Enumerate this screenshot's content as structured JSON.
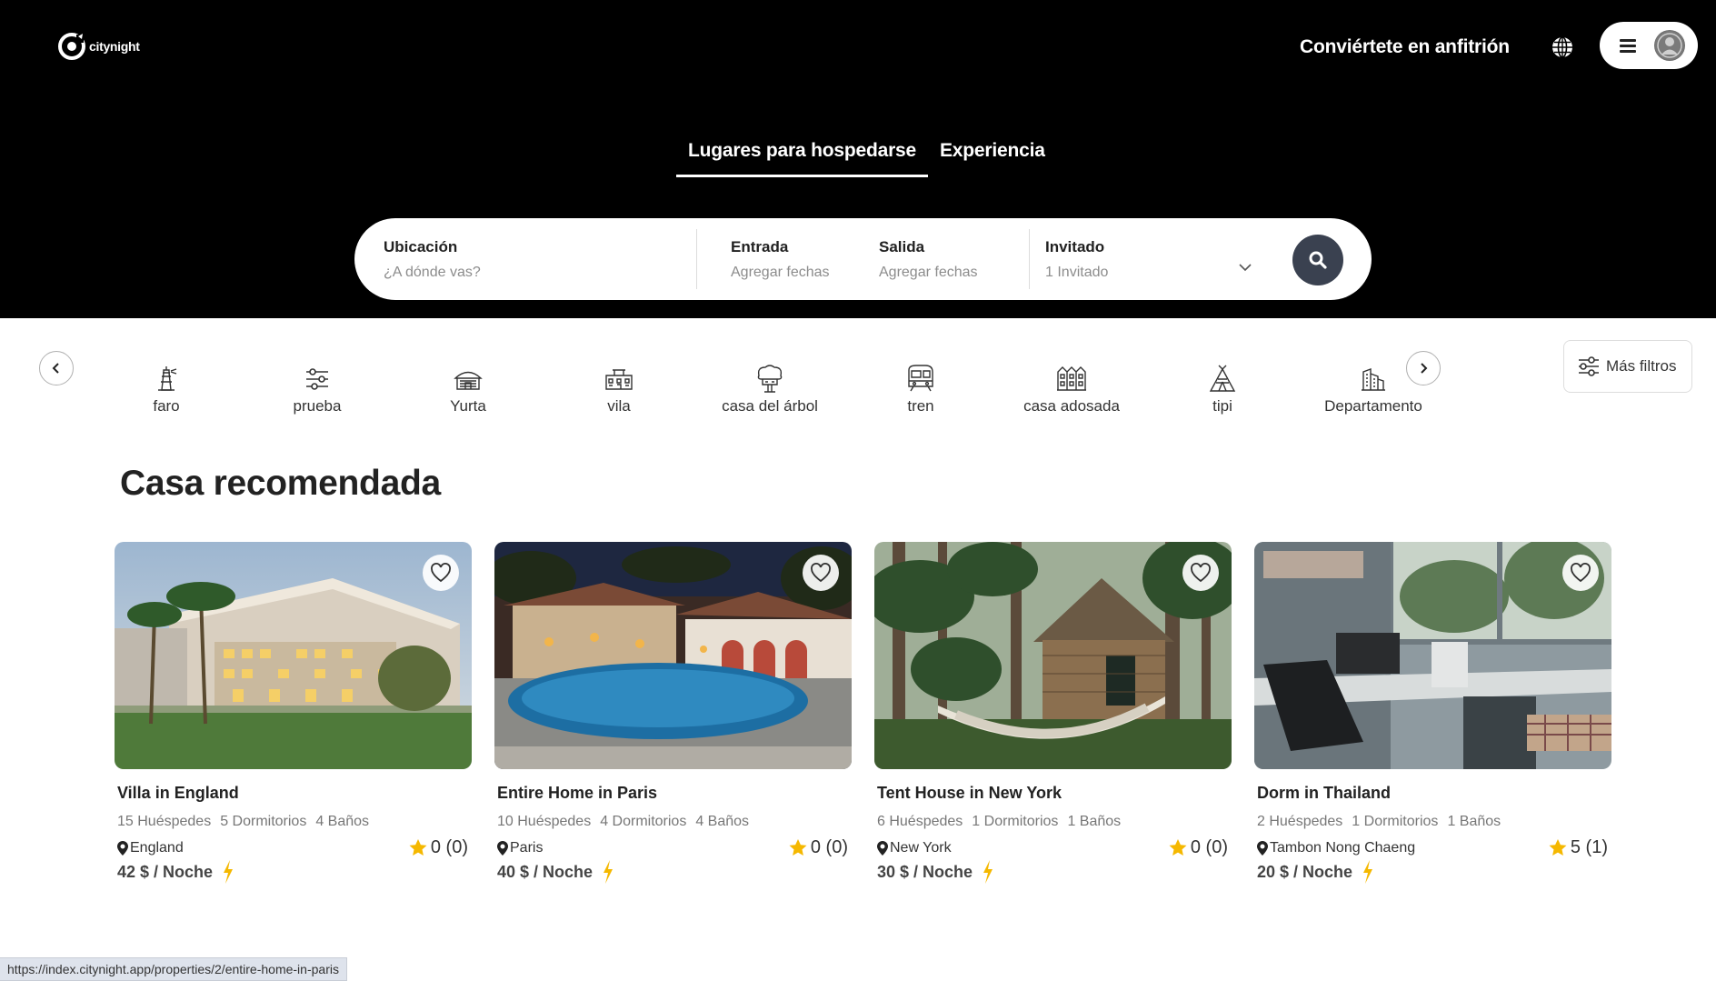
{
  "header": {
    "logo_text": "citynight",
    "host_label": "Conviértete en anfitrión",
    "tabs": [
      {
        "label": "Lugares para hospedarse",
        "active": true
      },
      {
        "label": "Experiencia",
        "active": false
      }
    ]
  },
  "search": {
    "location": {
      "label": "Ubicación",
      "placeholder": "¿A dónde vas?"
    },
    "checkin": {
      "label": "Entrada",
      "placeholder": "Agregar fechas"
    },
    "checkout": {
      "label": "Salida",
      "placeholder": "Agregar fechas"
    },
    "guests": {
      "label": "Invitado",
      "value": "1 Invitado"
    }
  },
  "categories": {
    "items": [
      {
        "label": "faro",
        "icon": "lighthouse-icon"
      },
      {
        "label": "prueba",
        "icon": "sliders-icon"
      },
      {
        "label": "Yurta",
        "icon": "yurt-icon"
      },
      {
        "label": "vila",
        "icon": "villa-icon"
      },
      {
        "label": "casa del árbol",
        "icon": "treehouse-icon"
      },
      {
        "label": "tren",
        "icon": "train-icon"
      },
      {
        "label": "casa adosada",
        "icon": "townhouse-icon"
      },
      {
        "label": "tipi",
        "icon": "tipi-icon"
      },
      {
        "label": "Departamento",
        "icon": "apartment-icon"
      }
    ],
    "more_filters_label": "Más filtros"
  },
  "section": {
    "title": "Casa recomendada",
    "listings": [
      {
        "title": "Villa in England",
        "guests": "15 Huéspedes",
        "bedrooms": "5 Dormitorios",
        "baths": "4 Baños",
        "location": "England",
        "rating": "0 (0)",
        "price": "42 $ / Noche"
      },
      {
        "title": "Entire Home in Paris",
        "guests": "10 Huéspedes",
        "bedrooms": "4 Dormitorios",
        "baths": "4 Baños",
        "location": "Paris",
        "rating": "0 (0)",
        "price": "40 $ / Noche"
      },
      {
        "title": "Tent House in New York",
        "guests": "6 Huéspedes",
        "bedrooms": "1 Dormitorios",
        "baths": "1 Baños",
        "location": "New York",
        "rating": "0 (0)",
        "price": "30 $ / Noche"
      },
      {
        "title": "Dorm in Thailand",
        "guests": "2 Huéspedes",
        "bedrooms": "1 Dormitorios",
        "baths": "1 Baños",
        "location": "Tambon Nong Chaeng",
        "rating": "5 (1)",
        "price": "20 $ / Noche"
      }
    ]
  },
  "status_bar": {
    "url": "https://index.citynight.app/properties/2/entire-home-in-paris"
  },
  "colors": {
    "hero_bg": "#000000",
    "search_button": "#3a4150",
    "star": "#f5b800",
    "bolt": "#f5b800"
  }
}
